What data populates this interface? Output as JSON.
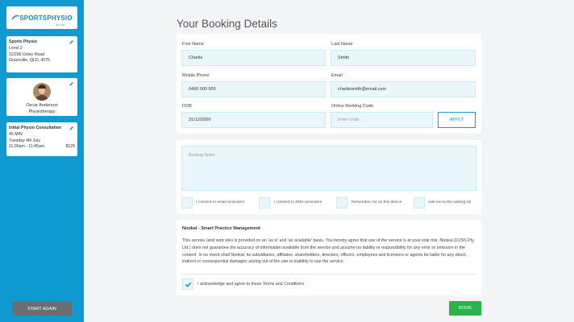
{
  "sidebar": {
    "logo": {
      "brand": "SPORTSPHYSIO",
      "sub": "@ 1 HR"
    },
    "clinic": {
      "name": "Sports Physio",
      "line1": "Level 2",
      "line2": "11/296 Oxley Road",
      "line3": "Graceville, QLD, 4075"
    },
    "practitioner": {
      "name": "Oscar Anderson",
      "role": "Physiotherapy"
    },
    "service": {
      "name": "Initial Physio Consultation",
      "duration": "45 MIN",
      "date": "Tuesday 4th July",
      "time": "11:00am - 11:45am",
      "price": "$129"
    },
    "start_again": "START AGAIN"
  },
  "main": {
    "title": "Your Booking Details",
    "fields": {
      "first_name": {
        "label": "First Name",
        "value": "Charlie"
      },
      "last_name": {
        "label": "Last Name",
        "value": "Smith"
      },
      "mobile": {
        "label": "Mobile Phone",
        "value": "0400 000 000"
      },
      "email": {
        "label": "Email",
        "value": "charliesmith@email.com"
      },
      "dob": {
        "label": "DOB",
        "value": "31/12/2000"
      },
      "code": {
        "label": "Online Booking Code",
        "placeholder": "Enter code"
      }
    },
    "apply": "APPLY",
    "notes_placeholder": "Booking Notes",
    "checkboxes": [
      "I consent to email reminders",
      "I consent to SMS reminders",
      "Remember me on this device",
      "Add me to the waiting list"
    ],
    "terms": {
      "title": "Nookal - Smart Practice Management",
      "body": "This service (and web site) is provided on an 'as is' and 'as available' basis. You hereby agree that use of the service is at your sole risk. Nookal (DJSS Pty. Ltd.) does not guarantee the accuracy of information available from the service and assume no liability or responsibility for any error or omission in the content. In no event shall Nookal, its subsidiaries, affiliates, shareholders, directors, officers, employees and licensors or agents be liable for any direct, indirect or consequential damages arising out of the use or inability to use the service.",
      "agree": "I acknowledge and agree to these Terms and Conditions"
    },
    "book": "BOOK"
  },
  "colors": {
    "accent": "#0f9bd1",
    "book": "#2ab34a",
    "field_bg": "#e9f7fd"
  }
}
